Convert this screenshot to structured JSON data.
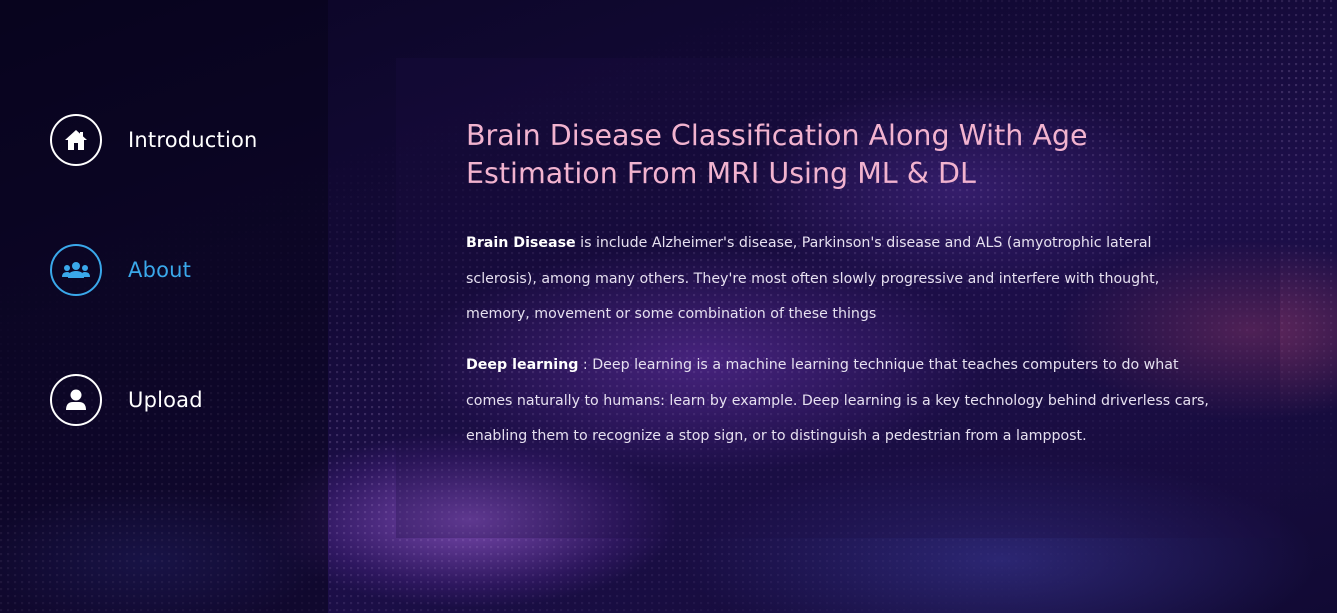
{
  "nav": {
    "items": [
      {
        "label": "Introduction",
        "icon": "home-icon"
      },
      {
        "label": "About",
        "icon": "users-icon"
      },
      {
        "label": "Upload",
        "icon": "user-icon"
      }
    ],
    "active_color": "#3aa8ea"
  },
  "main": {
    "title": "Brain Disease Classification Along With Age Estimation From MRI Using ML & DL",
    "paragraphs": [
      {
        "term": "Brain Disease",
        "text": " is include Alzheimer's disease, Parkinson's disease and ALS (amyotrophic lateral sclerosis), among many others. They're most often slowly progressive and interfere with thought, memory, movement or some combination of these things"
      },
      {
        "term": "Deep learning",
        "text": " : Deep learning is a machine learning technique that teaches computers to do what comes naturally to humans: learn by example. Deep learning is a key technology behind driverless cars, enabling them to recognize a stop sign, or to distinguish a pedestrian from a lamppost."
      }
    ]
  },
  "colors": {
    "title": "#f2b3cf",
    "text": "#e6e0f0",
    "sidebar_bg": "#08041a"
  }
}
